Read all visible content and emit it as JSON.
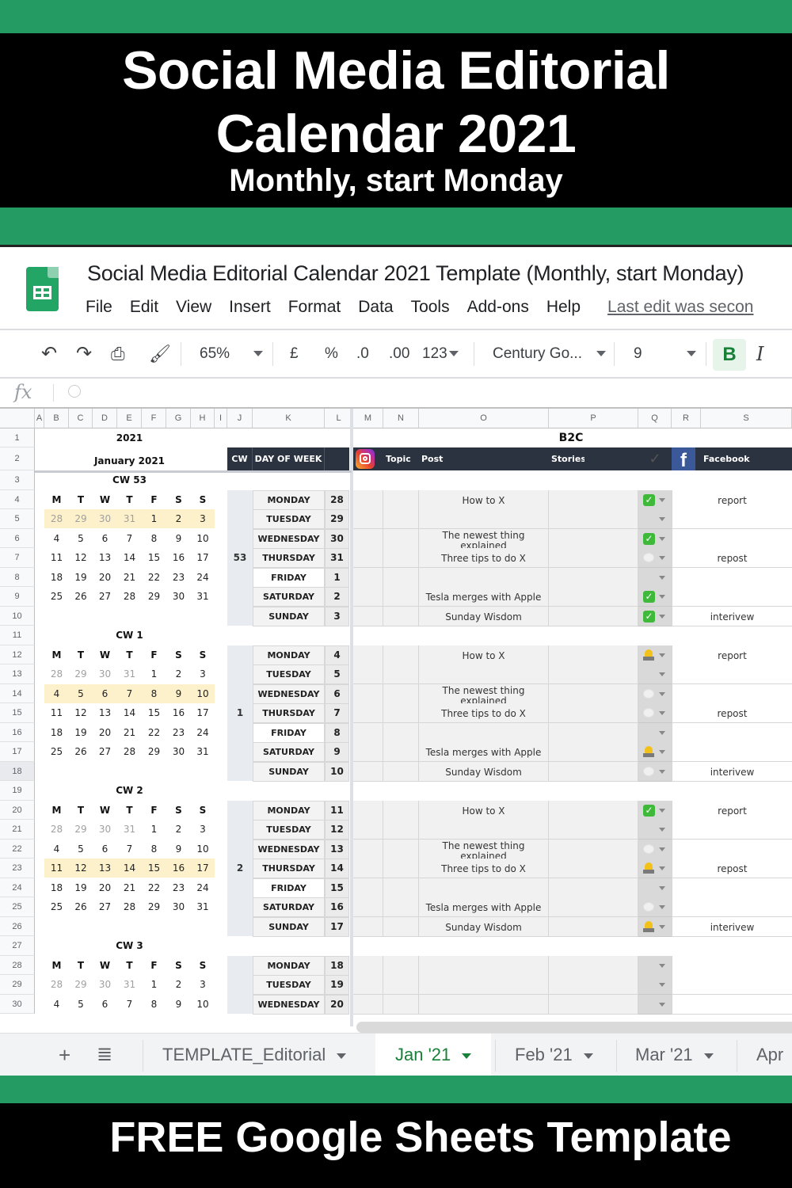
{
  "banner": {
    "title_line1": "Social Media Editorial",
    "title_line2": "Calendar 2021",
    "subtitle": "Monthly, start Monday",
    "footer": "FREE Google Sheets Template",
    "colors": {
      "green": "#239b63",
      "black": "#000000"
    }
  },
  "app": {
    "doc_title": "Social Media Editorial Calendar 2021 Template (Monthly, start Monday)",
    "menu": [
      "File",
      "Edit",
      "View",
      "Insert",
      "Format",
      "Data",
      "Tools",
      "Add-ons",
      "Help"
    ],
    "last_edit": "Last edit was secon",
    "toolbar": {
      "zoom": "65%",
      "currency": "£",
      "percent": "%",
      "dec_decrease": ".0",
      "dec_increase": ".00",
      "number_format": "123",
      "font": "Century Go...",
      "font_size": "9",
      "bold": "B",
      "italic": "I"
    },
    "formula_bar": {
      "fx": "fx",
      "value": ""
    }
  },
  "columns": [
    "A",
    "B",
    "C",
    "D",
    "E",
    "F",
    "G",
    "H",
    "I",
    "J",
    "K",
    "L",
    "M",
    "N",
    "O",
    "P",
    "Q",
    "R",
    "S"
  ],
  "rows": [
    "1",
    "2",
    "3",
    "4",
    "5",
    "6",
    "7",
    "8",
    "9",
    "10",
    "11",
    "12",
    "13",
    "14",
    "15",
    "16",
    "17",
    "18",
    "19",
    "20",
    "21",
    "22",
    "23",
    "24",
    "25",
    "26",
    "27",
    "28",
    "29",
    "30"
  ],
  "mini_calendar": {
    "year": "2021",
    "month": "January 2021",
    "weekday_headers": [
      "M",
      "T",
      "W",
      "T",
      "F",
      "S",
      "S"
    ],
    "weeks": [
      [
        "28",
        "29",
        "30",
        "31",
        "1",
        "2",
        "3"
      ],
      [
        "4",
        "5",
        "6",
        "7",
        "8",
        "9",
        "10"
      ],
      [
        "11",
        "12",
        "13",
        "14",
        "15",
        "16",
        "17"
      ],
      [
        "18",
        "19",
        "20",
        "21",
        "22",
        "23",
        "24"
      ],
      [
        "25",
        "26",
        "27",
        "28",
        "29",
        "30",
        "31"
      ]
    ],
    "blocks": [
      {
        "label": "CW 53",
        "highlight_week": 0
      },
      {
        "label": "CW 1",
        "highlight_week": 1
      },
      {
        "label": "CW 2",
        "highlight_week": 2
      },
      {
        "label": "CW 3",
        "highlight_week": 3
      }
    ],
    "highlight_color": "#fdf1cc"
  },
  "schedule": {
    "section_label": "B2C",
    "headers": {
      "cw": "CW",
      "day_of_week": "DAY OF WEEK",
      "topic": "Topic",
      "post": "Post",
      "stories": "Stories",
      "facebook": "Facebook"
    },
    "days": [
      "MONDAY",
      "TUESDAY",
      "WEDNESDAY",
      "THURSDAY",
      "FRIDAY",
      "SATURDAY",
      "SUNDAY"
    ],
    "weeks": [
      {
        "cw": "53",
        "dates": [
          "28",
          "29",
          "30",
          "31",
          "1",
          "2",
          "3"
        ],
        "posts": [
          "How to X",
          "",
          "The newest thing explained",
          "Three tips to do X",
          "",
          "Tesla merges with Apple",
          "Sunday Wisdom"
        ],
        "status": [
          "done",
          "none",
          "done",
          "pending",
          "none",
          "done",
          "done"
        ],
        "facebook": [
          "report",
          "",
          "",
          "repost",
          "",
          "",
          "interivew"
        ]
      },
      {
        "cw": "1",
        "dates": [
          "4",
          "5",
          "6",
          "7",
          "8",
          "9",
          "10"
        ],
        "posts": [
          "How to X",
          "",
          "The newest thing explained",
          "Three tips to do X",
          "",
          "Tesla merges with Apple",
          "Sunday Wisdom"
        ],
        "status": [
          "in_progress",
          "none",
          "pending",
          "pending",
          "none",
          "in_progress",
          "pending"
        ],
        "facebook": [
          "report",
          "",
          "",
          "repost",
          "",
          "",
          "interivew"
        ]
      },
      {
        "cw": "2",
        "dates": [
          "11",
          "12",
          "13",
          "14",
          "15",
          "16",
          "17"
        ],
        "posts": [
          "How to X",
          "",
          "The newest thing explained",
          "Three tips to do X",
          "",
          "Tesla merges with Apple",
          "Sunday Wisdom"
        ],
        "status": [
          "done",
          "none",
          "pending",
          "in_progress",
          "none",
          "pending",
          "in_progress"
        ],
        "facebook": [
          "report",
          "",
          "",
          "repost",
          "",
          "",
          "interivew"
        ]
      },
      {
        "cw": "",
        "dates": [
          "18",
          "19",
          "20"
        ],
        "posts": [
          "",
          "",
          ""
        ],
        "status": [
          "none",
          "none",
          "none"
        ],
        "facebook": [
          "",
          "",
          ""
        ]
      }
    ]
  },
  "sheet_tabs": [
    {
      "label": "TEMPLATE_Editorial",
      "active": false
    },
    {
      "label": "Jan '21",
      "active": true
    },
    {
      "label": "Feb '21",
      "active": false
    },
    {
      "label": "Mar '21",
      "active": false
    },
    {
      "label": "Apr",
      "active": false
    }
  ]
}
